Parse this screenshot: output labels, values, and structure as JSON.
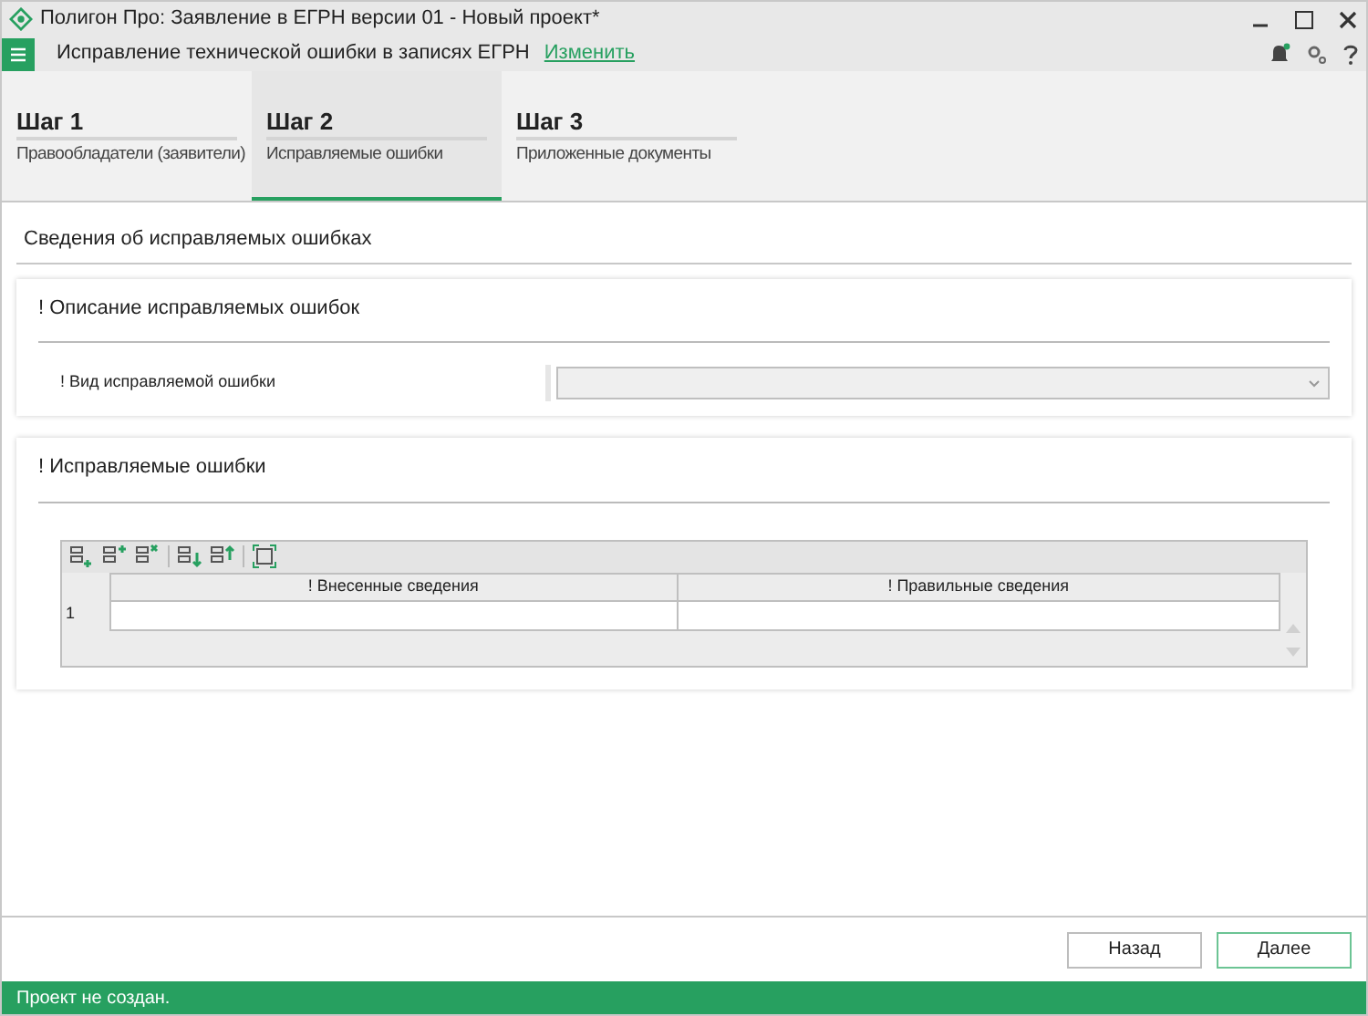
{
  "window": {
    "title": "Полигон Про: Заявление в ЕГРН версии 01 - Новый проект*"
  },
  "header": {
    "document": "Исправление технической ошибки в записях ЕГРН",
    "change_link": "Изменить",
    "notification": true
  },
  "steps": [
    {
      "title": "Шаг 1",
      "subtitle": "Правообладатели (заявители)",
      "selected": false
    },
    {
      "title": "Шаг 2",
      "subtitle": "Исправляемые ошибки",
      "selected": true
    },
    {
      "title": "Шаг 3",
      "subtitle": "Приложенные документы",
      "selected": false
    }
  ],
  "section_title": "Сведения об исправляемых ошибках",
  "description_panel": {
    "title": "! Описание исправляемых ошибок",
    "field_label": "! Вид исправляемой ошибки"
  },
  "errors_panel": {
    "title": "! Исправляемые ошибки",
    "table": {
      "columns": [
        "! Внесенные сведения",
        "! Правильные сведения"
      ],
      "rows": [
        {
          "number": "1"
        }
      ]
    }
  },
  "buttons": [
    {
      "label": "Назад",
      "primary": false
    },
    {
      "label": "Далее",
      "primary": true
    }
  ],
  "status_bar": "Проект не создан."
}
